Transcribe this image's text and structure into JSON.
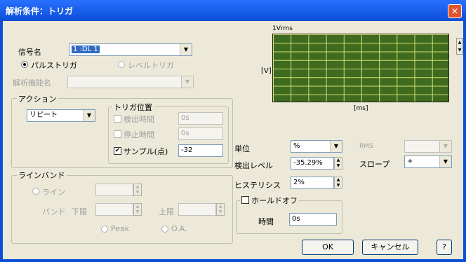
{
  "window": {
    "title": "解析条件：トリガ",
    "close_icon": "close-icon"
  },
  "signal": {
    "label": "信号名",
    "value": "1 :DL 1"
  },
  "trigger_type": {
    "pulse_label": "パルストリガ",
    "level_label": "レベルトリガ",
    "selected": "pulse"
  },
  "analysis_func": {
    "label": "解析機能名",
    "value": ""
  },
  "action": {
    "group_label": "アクション",
    "value": "リピート"
  },
  "trigger_pos": {
    "group_label": "トリガ位置",
    "detect_time_label": "検出時間",
    "detect_time_value": "0s",
    "stop_time_label": "停止時間",
    "stop_time_value": "0s",
    "sample_label": "サンプル(点)",
    "sample_value": "-32",
    "sample_checked": true
  },
  "plot": {
    "top_label": "1Vrms",
    "y_label": "[V]",
    "x_label": "[ms]",
    "color": "#3e6b1f",
    "grid_color": "#d8e070"
  },
  "unit": {
    "label": "単位",
    "value": "%"
  },
  "rms": {
    "label": "RMS",
    "value": ""
  },
  "detect_level": {
    "label": "検出レベル",
    "value": "-35.29%"
  },
  "slope": {
    "label": "スロープ",
    "value": "+"
  },
  "hysteresis": {
    "label": "ヒステリシス",
    "value": "2%"
  },
  "holdoff": {
    "label": "ホールドオフ",
    "checked": false,
    "time_label": "時間",
    "time_value": "0s"
  },
  "lineband": {
    "group_label": "ラインバンド",
    "line_label": "ライン",
    "band_label": "バンド",
    "lower_label": "下限",
    "upper_label": "上限",
    "peak_label": "Peak",
    "oa_label": "O.A."
  },
  "buttons": {
    "ok": "OK",
    "cancel": "キャンセル",
    "help": "?"
  }
}
